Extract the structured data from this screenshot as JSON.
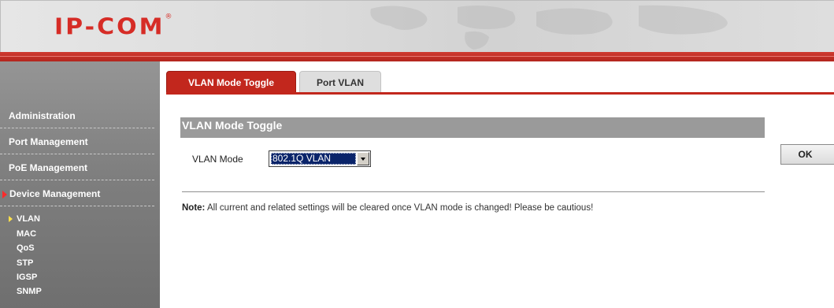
{
  "brand": {
    "logo_text": "IP-COM",
    "logo_mark": "®"
  },
  "sidebar": {
    "items": [
      {
        "label": "Administration",
        "active": false
      },
      {
        "label": "Port Management",
        "active": false
      },
      {
        "label": "PoE Management",
        "active": false
      },
      {
        "label": "Device Management",
        "active": true
      }
    ],
    "subitems": [
      {
        "label": "VLAN",
        "active": true
      },
      {
        "label": "MAC",
        "active": false
      },
      {
        "label": "QoS",
        "active": false
      },
      {
        "label": "STP",
        "active": false
      },
      {
        "label": "IGSP",
        "active": false
      },
      {
        "label": "SNMP",
        "active": false
      }
    ]
  },
  "tabs": [
    {
      "label": "VLAN Mode Toggle",
      "active": true
    },
    {
      "label": "Port VLAN",
      "active": false
    }
  ],
  "panel": {
    "title": "VLAN Mode Toggle",
    "mode_label": "VLAN Mode",
    "mode_value": "802.1Q VLAN",
    "ok_label": "OK",
    "note_prefix": "Note:",
    "note_text": " All current and related settings will be cleared once VLAN mode is changed! Please be cautious!"
  },
  "colors": {
    "accent_red": "#c2271d",
    "sidebar_gray": "#7f7f7f",
    "panel_head": "#9a9a9a",
    "logo_red": "#d62c26"
  }
}
